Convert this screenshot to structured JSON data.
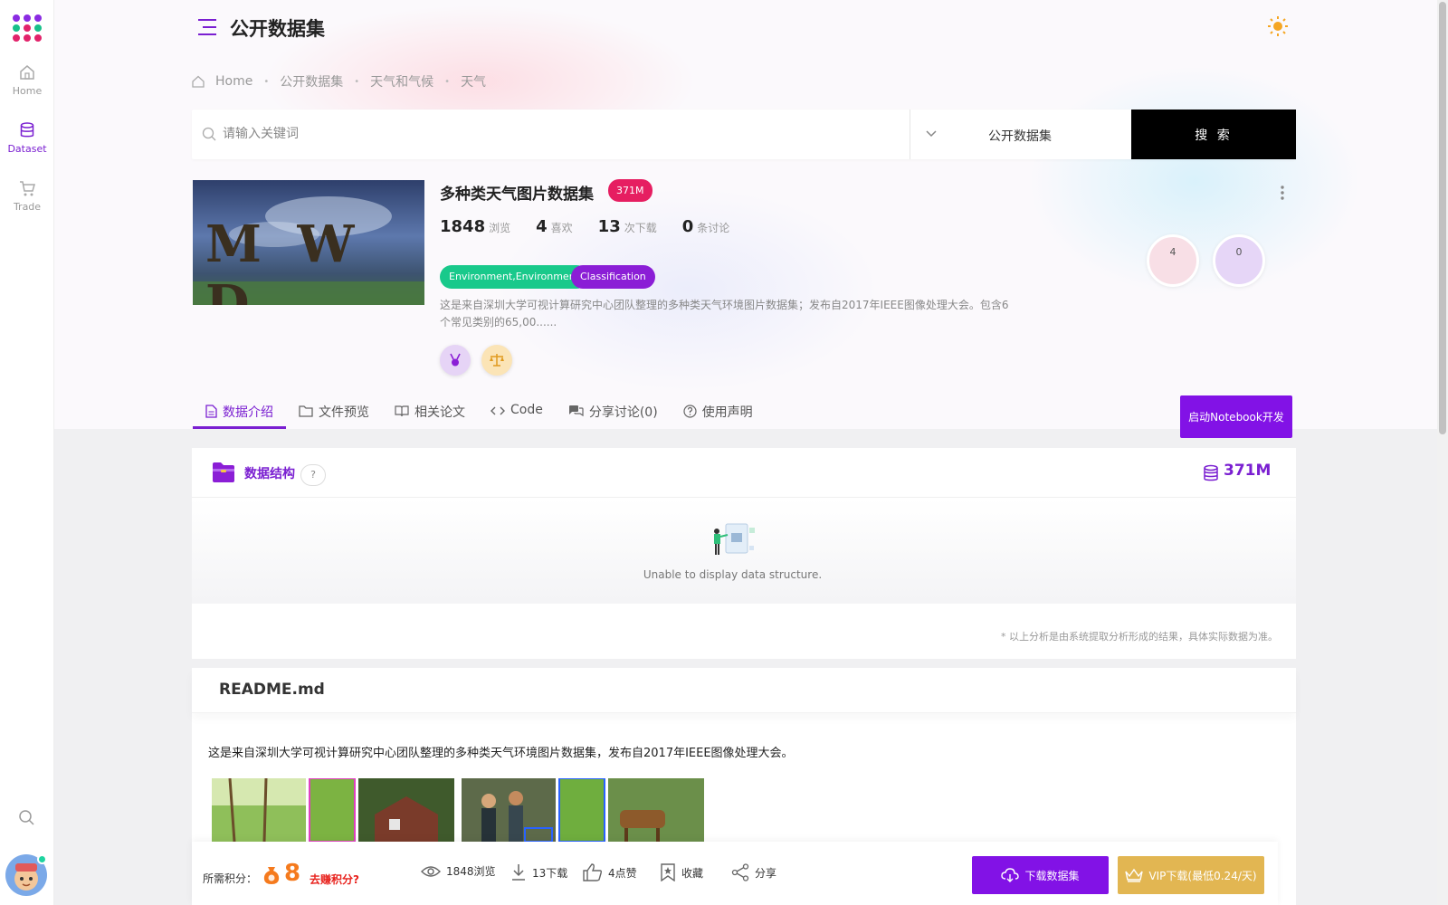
{
  "sidebar": {
    "items": [
      {
        "label": "Home",
        "icon": "home-icon"
      },
      {
        "label": "Dataset",
        "icon": "database-icon",
        "active": true
      },
      {
        "label": "Trade",
        "icon": "cart-icon"
      }
    ]
  },
  "header": {
    "title": "公开数据集"
  },
  "breadcrumb": [
    "Home",
    "公开数据集",
    "天气和气候",
    "天气"
  ],
  "search": {
    "placeholder": "请输入关键词",
    "scope": "公开数据集",
    "button": "搜 索"
  },
  "dataset": {
    "cover_text": "M W D",
    "title": "多种类天气图片数据集",
    "size_badge": "371M",
    "stats": [
      {
        "value": "1848",
        "label": "浏览"
      },
      {
        "value": "4",
        "label": "喜欢"
      },
      {
        "value": "13",
        "label": "次下载"
      },
      {
        "value": "0",
        "label": "条讨论"
      }
    ],
    "tags": [
      "Environment,Environment",
      "Classification"
    ],
    "description": "这是来自深圳大学可视计算研究中心团队整理的多种类天气环境图片数据集；发布自2017年IEEE图像处理大会。包含6个常见类别的65,00......",
    "circle_values": [
      "4",
      "0"
    ]
  },
  "tabs": [
    {
      "label": "数据介绍",
      "icon": "file-icon",
      "active": true
    },
    {
      "label": "文件预览",
      "icon": "folder-icon"
    },
    {
      "label": "相关论文",
      "icon": "book-icon"
    },
    {
      "label": "Code",
      "icon": "code-icon"
    },
    {
      "label": "分享讨论(0)",
      "icon": "chat-icon"
    },
    {
      "label": "使用声明",
      "icon": "question-icon"
    }
  ],
  "notebook_button": "启动Notebook开发",
  "structure": {
    "title": "数据结构",
    "help": "?",
    "total_size": "371M",
    "empty_text": "Unable to display data structure.",
    "note": "* 以上分析是由系统提取分析形成的结果，具体实际数据为准。"
  },
  "readme": {
    "title": "README.md",
    "intro": "这是来自深圳大学可视计算研究中心团队整理的多种类天气环境图片数据集，发布自2017年IEEE图像处理大会。"
  },
  "bottom": {
    "points_label": "所需积分：",
    "points_value": "8",
    "earn_link": "去赚积分?",
    "views": "1848浏览",
    "downloads": "13下载",
    "likes": "4点赞",
    "favorite": "收藏",
    "share": "分享",
    "download_button": "下载数据集",
    "vip_button": "VIP下载(最低0.24/天)"
  },
  "colors": {
    "accent": "#8212e6",
    "badge_red": "#e61e61",
    "tag_green": "#19c98b",
    "tag_purple": "#8b1ed6",
    "vip_gold": "#e2b652",
    "points_orange": "#f57a1d"
  }
}
